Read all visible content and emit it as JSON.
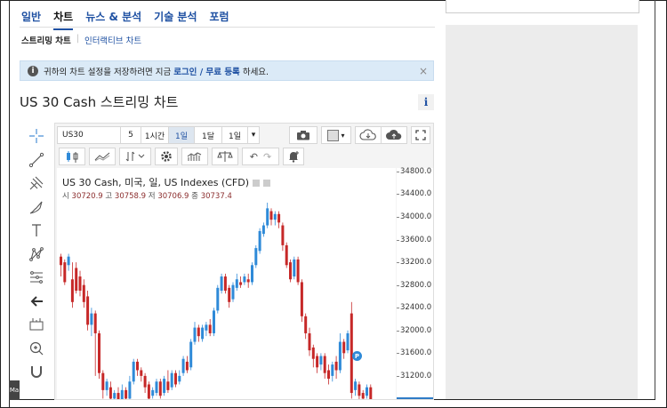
{
  "nav": {
    "items": [
      {
        "label": "일반",
        "active": false
      },
      {
        "label": "차트",
        "active": true
      },
      {
        "label": "뉴스 & 분석",
        "active": false
      },
      {
        "label": "기술 분석",
        "active": false
      },
      {
        "label": "포럼",
        "active": false
      }
    ]
  },
  "subnav": {
    "streaming": "스트리밍 차트",
    "interactive": "인터랙티브 차트"
  },
  "notice": {
    "text_before": "귀하의 차트 설정을 저장하려면 지금 ",
    "login": "로그인",
    "sep": " / ",
    "register": "무료 등록",
    "text_after": " 하세요.",
    "close": "×"
  },
  "page": {
    "title": "US 30 Cash 스트리밍 차트",
    "info": "i"
  },
  "drawing_tools": [
    "crosshair-icon",
    "trend-line-icon",
    "pitchfork-icon",
    "brush-icon",
    "text-icon",
    "pattern-icon",
    "fibonacci-icon",
    "back-arrow-icon",
    "measure-icon",
    "zoom-in-icon",
    "magnet-icon"
  ],
  "toolbar": {
    "symbol": "US30",
    "interval": "5",
    "timeframes": [
      "1시간",
      "1일",
      "1달",
      "1일"
    ],
    "active_timeframe": 1,
    "dropdown": "▾"
  },
  "legend": {
    "title": "US 30 Cash, 미국, 일, US Indexes (CFD)",
    "open_label": "시",
    "open": "30720.9",
    "high_label": "고",
    "high": "30758.9",
    "low_label": "저",
    "low": "30706.9",
    "close_label": "종",
    "close": "30737.4"
  },
  "colors": {
    "up": "#2f8ad8",
    "down": "#c62828",
    "accent": "#1e50a2"
  },
  "marker": "P",
  "left_badge": "Ma",
  "chart_data": {
    "type": "candlestick",
    "y_axis_labels": [
      "34800.0",
      "34400.0",
      "34000.0",
      "33600.0",
      "33200.0",
      "32800.0",
      "32400.0",
      "32000.0",
      "31600.0",
      "31200.0"
    ],
    "ylim": [
      30760,
      34860
    ],
    "candles": [
      [
        33300,
        33150,
        33350,
        32950
      ],
      [
        33200,
        32850,
        33250,
        32800
      ],
      [
        33150,
        33300,
        33350,
        33050
      ],
      [
        32900,
        32500,
        33200,
        32400
      ],
      [
        33100,
        32700,
        33200,
        32650
      ],
      [
        32950,
        32700,
        33050,
        32600
      ],
      [
        32800,
        32500,
        32900,
        32400
      ],
      [
        32600,
        32100,
        32700,
        32000
      ],
      [
        32100,
        32300,
        32400,
        31900
      ],
      [
        32300,
        31950,
        32350,
        31200
      ],
      [
        31950,
        31250,
        32000,
        31150
      ],
      [
        31250,
        30950,
        31300,
        30800
      ],
      [
        30950,
        31100,
        31150,
        30850
      ],
      [
        31000,
        30800,
        31100,
        30700
      ],
      [
        30800,
        30900,
        30950,
        30700
      ],
      [
        30900,
        30750,
        31000,
        30650
      ],
      [
        30750,
        30950,
        31050,
        30700
      ],
      [
        30950,
        30800,
        31000,
        30700
      ],
      [
        30800,
        31100,
        31200,
        30750
      ],
      [
        31100,
        31450,
        31500,
        31050
      ],
      [
        31450,
        31300,
        31500,
        31200
      ],
      [
        31300,
        31200,
        31350,
        31100
      ],
      [
        31200,
        31000,
        31250,
        30900
      ],
      [
        31050,
        30800,
        31100,
        30750
      ],
      [
        30850,
        30950,
        31000,
        30800
      ],
      [
        30900,
        31100,
        31150,
        30850
      ],
      [
        31100,
        30850,
        31150,
        30800
      ],
      [
        30900,
        31150,
        31200,
        30850
      ],
      [
        31100,
        30950,
        31300,
        30900
      ],
      [
        31000,
        31250,
        31300,
        30950
      ],
      [
        31250,
        31050,
        31300,
        31000
      ],
      [
        31100,
        31200,
        31300,
        31050
      ],
      [
        31250,
        31500,
        31550,
        31200
      ],
      [
        31450,
        31300,
        31550,
        31250
      ],
      [
        31350,
        31800,
        31850,
        31300
      ],
      [
        31800,
        32050,
        32150,
        31750
      ],
      [
        32050,
        31900,
        32100,
        31800
      ],
      [
        31850,
        32050,
        32100,
        31800
      ],
      [
        32000,
        32100,
        32150,
        31900
      ],
      [
        32100,
        31950,
        32200,
        31900
      ],
      [
        31950,
        32350,
        32400,
        31900
      ],
      [
        32350,
        32750,
        32800,
        32300
      ],
      [
        32700,
        32950,
        33000,
        32650
      ],
      [
        32950,
        32700,
        33000,
        32650
      ],
      [
        32750,
        32500,
        32800,
        32400
      ],
      [
        32550,
        32800,
        32850,
        32500
      ],
      [
        32750,
        32900,
        33000,
        32700
      ],
      [
        32850,
        32800,
        32950,
        32750
      ],
      [
        32850,
        32950,
        33000,
        32800
      ],
      [
        32900,
        32850,
        33000,
        32750
      ],
      [
        32850,
        33150,
        33200,
        32800
      ],
      [
        33150,
        33450,
        33500,
        33100
      ],
      [
        33400,
        33750,
        33800,
        33350
      ],
      [
        33700,
        33850,
        33900,
        33650
      ],
      [
        33850,
        34150,
        34250,
        33800
      ],
      [
        34100,
        33950,
        34150,
        33850
      ],
      [
        33950,
        34050,
        34100,
        33850
      ],
      [
        34050,
        33900,
        34100,
        33800
      ],
      [
        33850,
        33500,
        33900,
        33400
      ],
      [
        33500,
        33150,
        33550,
        33100
      ],
      [
        33200,
        32900,
        33250,
        32850
      ],
      [
        32950,
        33250,
        33300,
        32900
      ],
      [
        33250,
        32850,
        33300,
        32800
      ],
      [
        32850,
        32250,
        32900,
        32150
      ],
      [
        32250,
        31950,
        32300,
        31850
      ],
      [
        31950,
        31650,
        32050,
        31550
      ],
      [
        31700,
        31500,
        31750,
        31350
      ],
      [
        31550,
        31350,
        31600,
        31250
      ],
      [
        31400,
        31550,
        31600,
        31300
      ],
      [
        31550,
        31250,
        31600,
        31150
      ],
      [
        31300,
        31150,
        31400,
        31050
      ],
      [
        31200,
        31400,
        31450,
        31100
      ],
      [
        31450,
        31300,
        31550,
        31150
      ],
      [
        31300,
        31800,
        31950,
        31250
      ],
      [
        31800,
        31600,
        31850,
        31500
      ],
      [
        31650,
        31950,
        32000,
        31600
      ],
      [
        32300,
        30900,
        32500,
        30800
      ],
      [
        30950,
        31100,
        31150,
        30850
      ],
      [
        31050,
        30850,
        31100,
        30700
      ],
      [
        30900,
        30800,
        30950,
        30750
      ],
      [
        30850,
        31000,
        31050,
        30800
      ],
      [
        31000,
        30760,
        31050,
        30700
      ]
    ],
    "last_price": "30737.4"
  }
}
